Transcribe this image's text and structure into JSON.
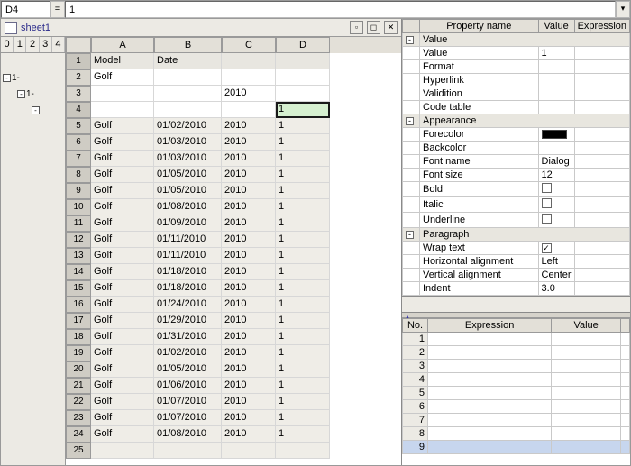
{
  "formula_bar": {
    "cell_ref": "D4",
    "eq": "=",
    "value": "1"
  },
  "window": {
    "title": "sheet1"
  },
  "outline": {
    "levels": [
      "0",
      "1",
      "2",
      "3",
      "4"
    ]
  },
  "columns": [
    "A",
    "B",
    "C",
    "D"
  ],
  "header_row": {
    "num": "1",
    "A": "Model",
    "B": "Date",
    "C": "",
    "D": ""
  },
  "group_rows": [
    {
      "num": "2",
      "A": "Golf",
      "B": "",
      "C": "",
      "D": ""
    },
    {
      "num": "3",
      "A": "",
      "B": "",
      "C": "2010",
      "D": ""
    }
  ],
  "active_row": {
    "num": "4",
    "A": "",
    "B": "",
    "C": "",
    "D": "1"
  },
  "data_rows": [
    {
      "num": "5",
      "A": "Golf",
      "B": "01/02/2010",
      "C": "2010",
      "D": "1"
    },
    {
      "num": "6",
      "A": "Golf",
      "B": "01/03/2010",
      "C": "2010",
      "D": "1"
    },
    {
      "num": "7",
      "A": "Golf",
      "B": "01/03/2010",
      "C": "2010",
      "D": "1"
    },
    {
      "num": "8",
      "A": "Golf",
      "B": "01/05/2010",
      "C": "2010",
      "D": "1"
    },
    {
      "num": "9",
      "A": "Golf",
      "B": "01/05/2010",
      "C": "2010",
      "D": "1"
    },
    {
      "num": "10",
      "A": "Golf",
      "B": "01/08/2010",
      "C": "2010",
      "D": "1"
    },
    {
      "num": "11",
      "A": "Golf",
      "B": "01/09/2010",
      "C": "2010",
      "D": "1"
    },
    {
      "num": "12",
      "A": "Golf",
      "B": "01/11/2010",
      "C": "2010",
      "D": "1"
    },
    {
      "num": "13",
      "A": "Golf",
      "B": "01/11/2010",
      "C": "2010",
      "D": "1"
    },
    {
      "num": "14",
      "A": "Golf",
      "B": "01/18/2010",
      "C": "2010",
      "D": "1"
    },
    {
      "num": "15",
      "A": "Golf",
      "B": "01/18/2010",
      "C": "2010",
      "D": "1"
    },
    {
      "num": "16",
      "A": "Golf",
      "B": "01/24/2010",
      "C": "2010",
      "D": "1"
    },
    {
      "num": "17",
      "A": "Golf",
      "B": "01/29/2010",
      "C": "2010",
      "D": "1"
    },
    {
      "num": "18",
      "A": "Golf",
      "B": "01/31/2010",
      "C": "2010",
      "D": "1"
    },
    {
      "num": "19",
      "A": "Golf",
      "B": "01/02/2010",
      "C": "2010",
      "D": "1"
    },
    {
      "num": "20",
      "A": "Golf",
      "B": "01/05/2010",
      "C": "2010",
      "D": "1"
    },
    {
      "num": "21",
      "A": "Golf",
      "B": "01/06/2010",
      "C": "2010",
      "D": "1"
    },
    {
      "num": "22",
      "A": "Golf",
      "B": "01/07/2010",
      "C": "2010",
      "D": "1"
    },
    {
      "num": "23",
      "A": "Golf",
      "B": "01/07/2010",
      "C": "2010",
      "D": "1"
    },
    {
      "num": "24",
      "A": "Golf",
      "B": "01/08/2010",
      "C": "2010",
      "D": "1"
    },
    {
      "num": "25",
      "A": "",
      "B": "",
      "C": "",
      "D": ""
    }
  ],
  "props": {
    "hdr": {
      "name": "Property name",
      "value": "Value",
      "expr": "Expression"
    },
    "sections": {
      "value": "Value",
      "appearance": "Appearance",
      "paragraph": "Paragraph"
    },
    "items": {
      "value": {
        "k": "Value",
        "v": "1"
      },
      "format": {
        "k": "Format",
        "v": ""
      },
      "hyperlink": {
        "k": "Hyperlink",
        "v": ""
      },
      "validation": {
        "k": "Validition",
        "v": ""
      },
      "codetable": {
        "k": "Code table",
        "v": ""
      },
      "forecolor": {
        "k": "Forecolor",
        "v": ""
      },
      "backcolor": {
        "k": "Backcolor",
        "v": ""
      },
      "fontname": {
        "k": "Font name",
        "v": "Dialog"
      },
      "fontsize": {
        "k": "Font size",
        "v": "12"
      },
      "bold": {
        "k": "Bold",
        "v": ""
      },
      "italic": {
        "k": "Italic",
        "v": ""
      },
      "underline": {
        "k": "Underline",
        "v": ""
      },
      "wrap": {
        "k": "Wrap text",
        "v": "✓"
      },
      "halign": {
        "k": "Horizontal alignment",
        "v": "Left"
      },
      "valign": {
        "k": "Vertical alignment",
        "v": "Center"
      },
      "indent": {
        "k": "Indent",
        "v": "3.0"
      }
    }
  },
  "expr": {
    "hdr": {
      "no": "No.",
      "expr": "Expression",
      "value": "Value"
    },
    "rows": [
      "1",
      "2",
      "3",
      "4",
      "5",
      "6",
      "7",
      "8",
      "9"
    ]
  }
}
